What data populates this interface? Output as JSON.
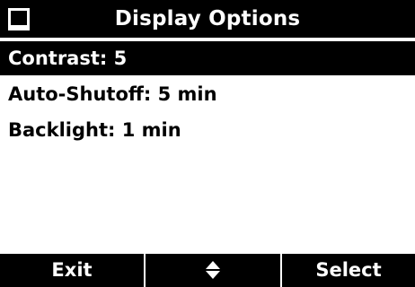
{
  "header": {
    "title": "Display Options",
    "icon": "screen-icon"
  },
  "menu": {
    "items": [
      {
        "label": "Contrast: 5",
        "selected": true
      },
      {
        "label": "Auto-Shutoff: 5 min",
        "selected": false
      },
      {
        "label": "Backlight: 1 min",
        "selected": false
      }
    ]
  },
  "softkeys": {
    "left": "Exit",
    "middle_icon": "up-down-arrows-icon",
    "right": "Select"
  },
  "colors": {
    "foreground": "#000000",
    "background": "#ffffff"
  }
}
